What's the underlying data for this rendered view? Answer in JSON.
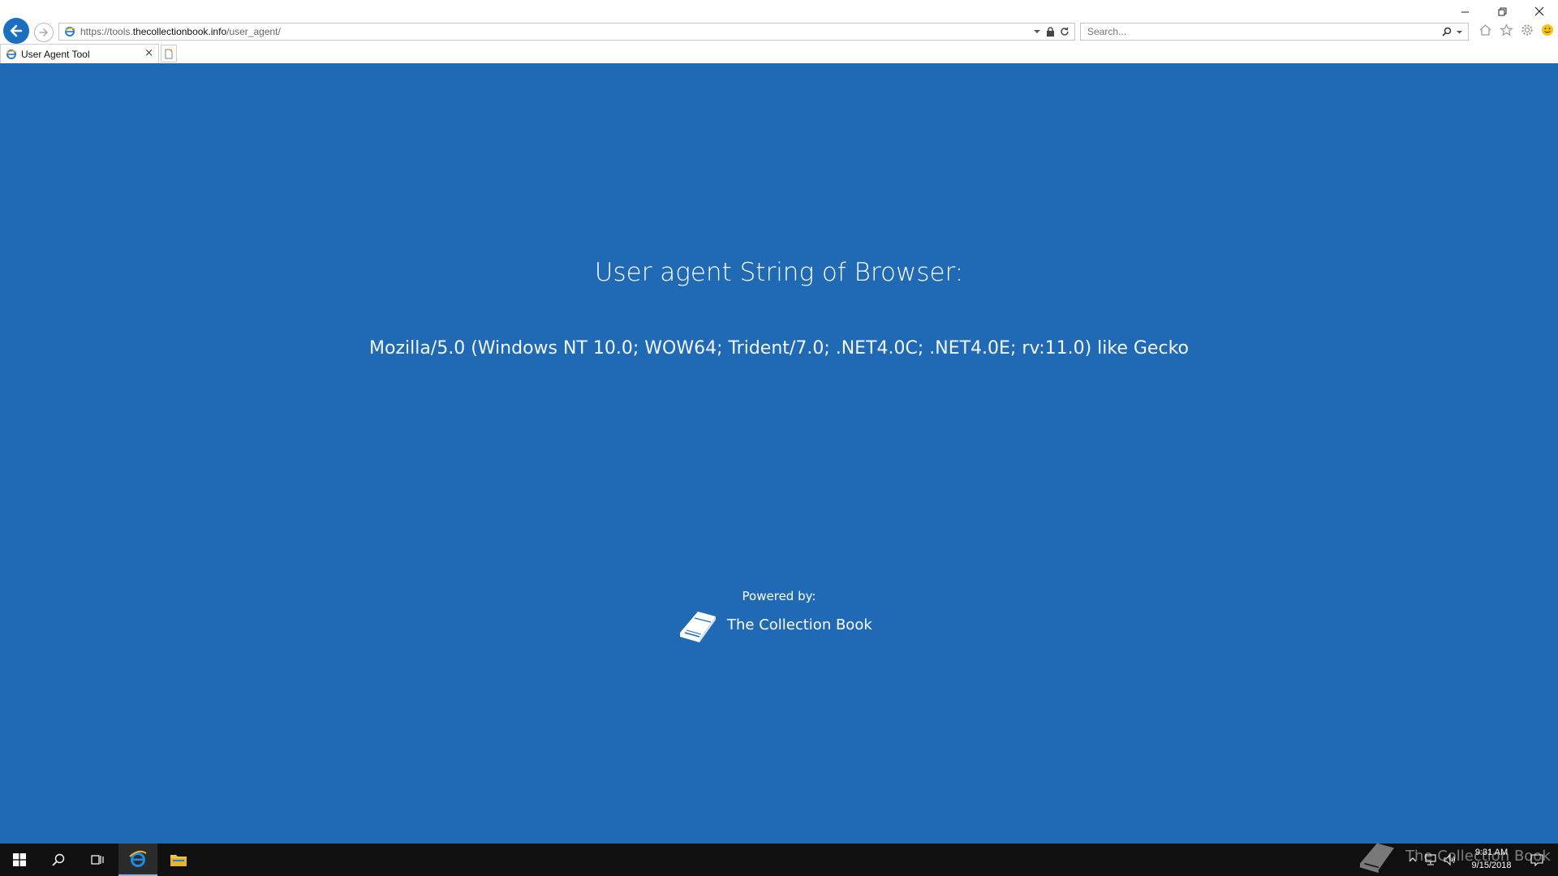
{
  "browser": {
    "url_prefix": "https://tools.",
    "url_domain": "thecollectionbook.info",
    "url_path": "/user_agent/",
    "search_placeholder": "Search...",
    "tab_title": "User Agent Tool",
    "tab_close": "×"
  },
  "page": {
    "heading": "User agent String of Browser:",
    "user_agent": "Mozilla/5.0 (Windows NT 10.0; WOW64; Trident/7.0; .NET4.0C; .NET4.0E; rv:11.0) like Gecko",
    "powered_by": "Powered by:",
    "brand_name": "The Collection Book"
  },
  "taskbar": {
    "watermark": "The Collection Book",
    "time": "9:31 AM",
    "date": "9/15/2018"
  },
  "colors": {
    "page_bg": "#1f69b5",
    "accent": "#1b6fbf",
    "taskbar_bg": "#101010"
  }
}
